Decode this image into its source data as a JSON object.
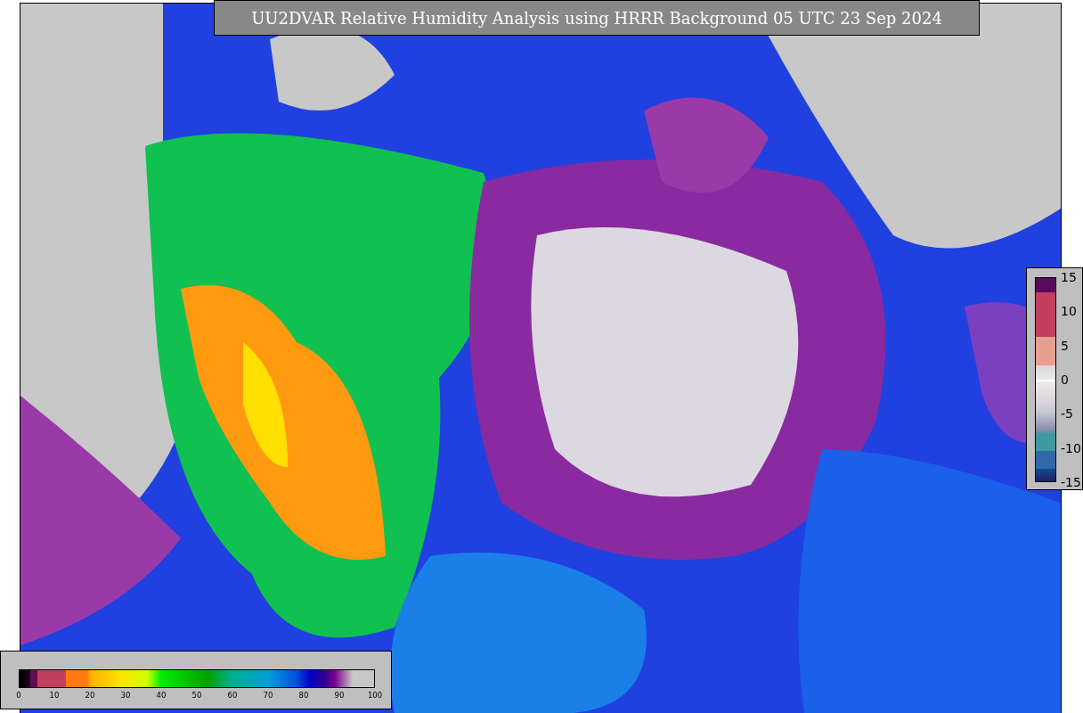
{
  "title": "UU2DVAR Relative Humidity Analysis using HRRR Background 05 UTC 23 Sep 2024",
  "increment_colorbar": {
    "ticks": [
      "15",
      "10",
      "5",
      "0",
      "-5",
      "-10",
      "-15"
    ]
  },
  "humidity_colorbar": {
    "ticks": [
      "0",
      "10",
      "20",
      "30",
      "40",
      "50",
      "60",
      "70",
      "80",
      "90",
      "100"
    ]
  }
}
